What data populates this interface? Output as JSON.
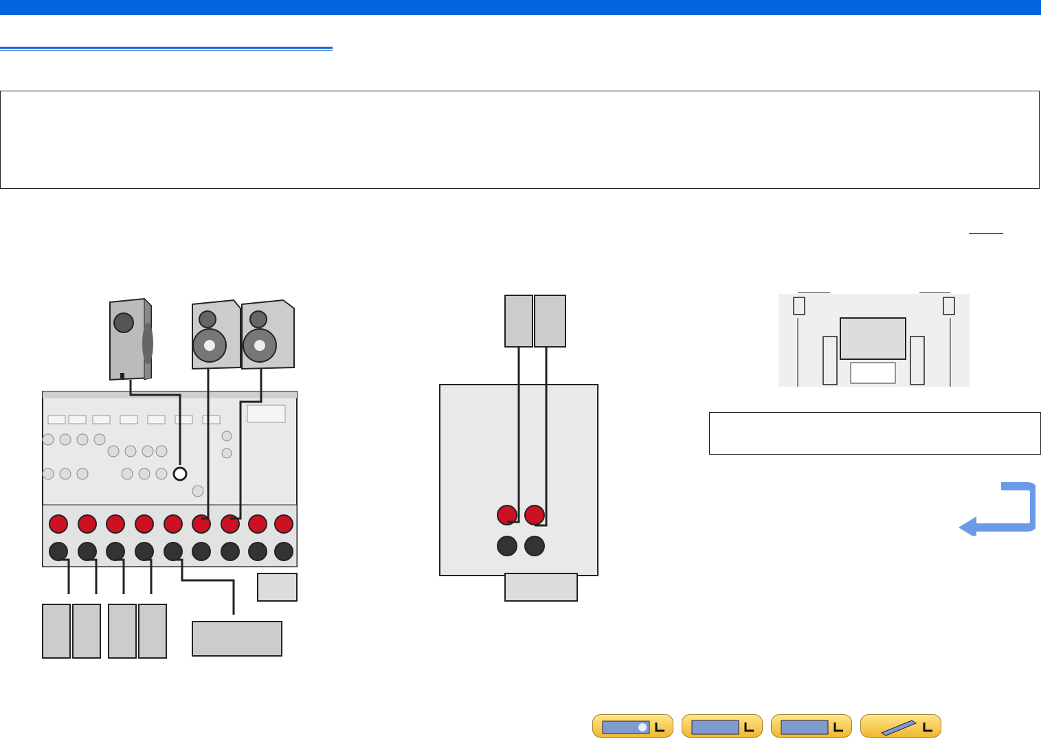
{
  "colors": {
    "accent": "#0066dd",
    "terminal_red": "#cc1122",
    "nav_button": "#f5c542"
  },
  "header": {
    "bar": "",
    "title": ""
  },
  "note_box": {
    "text": ""
  },
  "main_figure": {
    "name": "rear-panel-speaker-wiring"
  },
  "front_presence_figure": {
    "name": "front-presence-wiring"
  },
  "room_layout_figure": {
    "name": "presence-speaker-placement"
  },
  "side_note": {
    "text": ""
  },
  "nav": [
    {
      "icon": "receiver-front-icon"
    },
    {
      "icon": "rear-panel-icon"
    },
    {
      "icon": "menu-grid-icon"
    },
    {
      "icon": "remote-control-icon"
    }
  ]
}
